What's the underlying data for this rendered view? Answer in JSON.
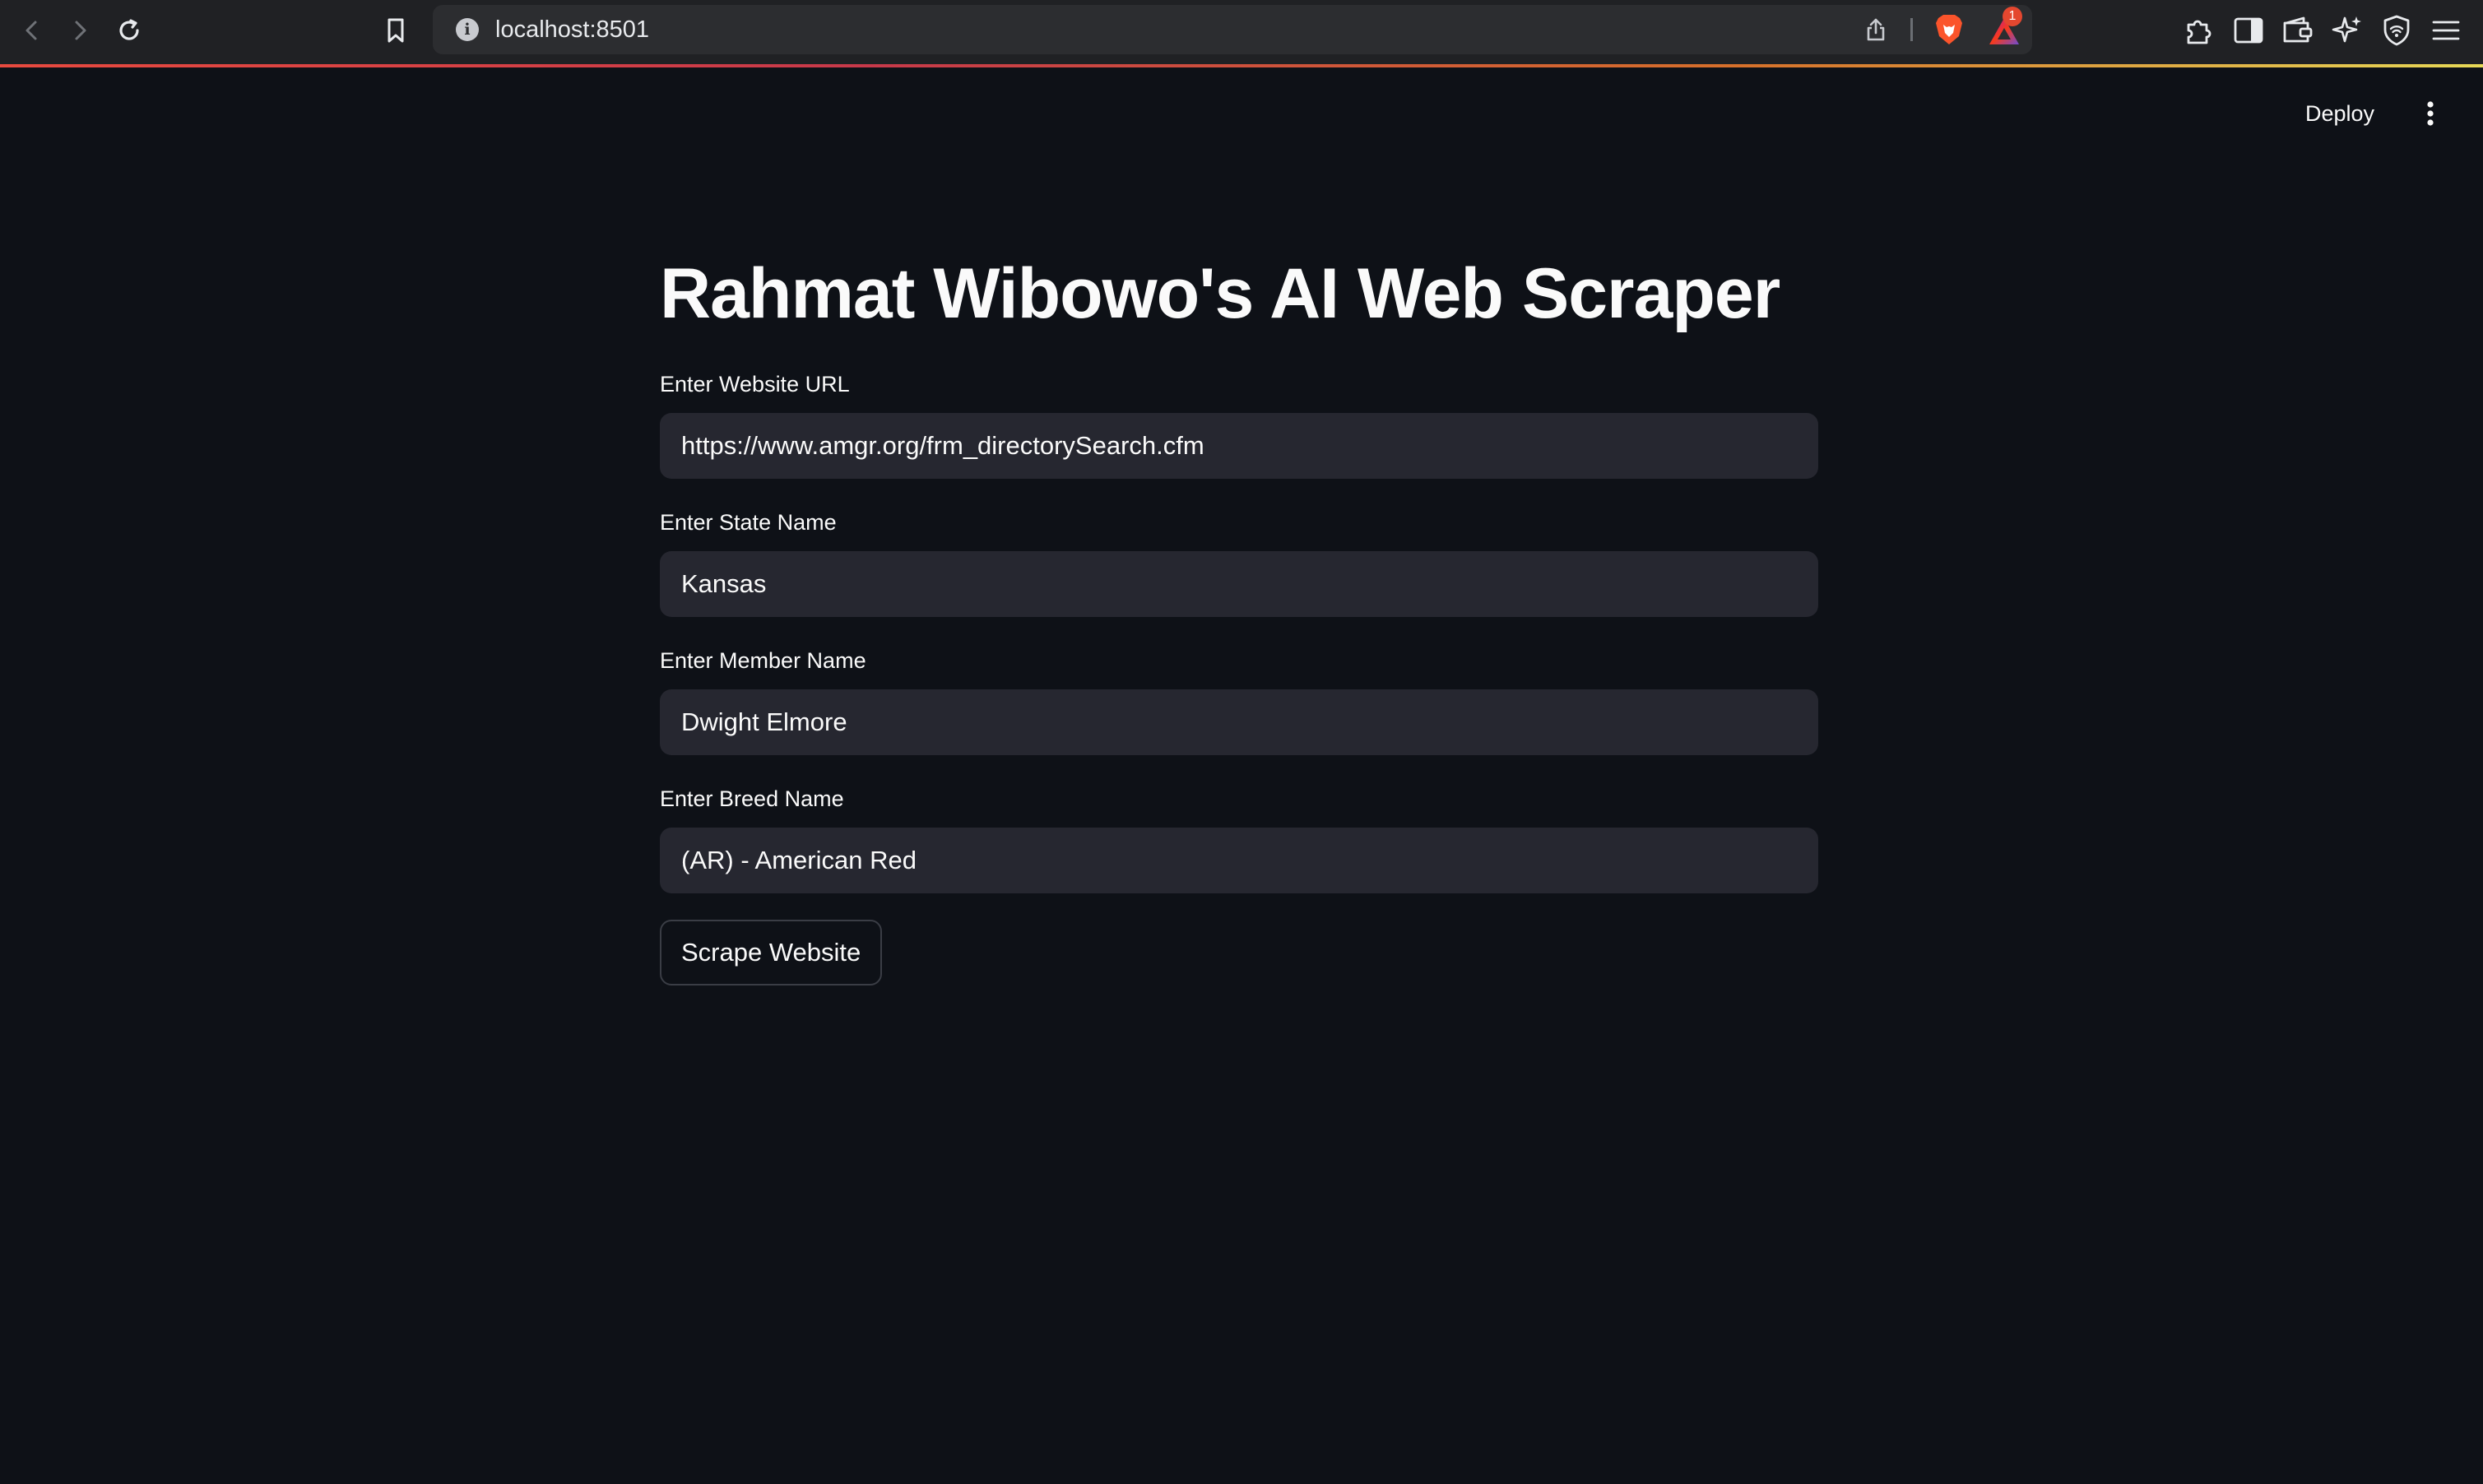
{
  "browser": {
    "url": "localhost:8501",
    "url_info_glyph": "i",
    "notification_count": "1",
    "icons": {
      "back": "chevron-left-icon",
      "forward": "chevron-right-icon",
      "reload": "reload-icon",
      "bookmark": "bookmark-icon",
      "site_info": "info-icon",
      "share": "share-icon",
      "brave_shields": "brave-lion-icon",
      "brave_rewards": "rewards-triangle-icon",
      "extensions": "puzzle-icon",
      "sidebar": "sidebar-icon",
      "wallet": "wallet-icon",
      "leo": "sparkle-icon",
      "vpn": "shield-icon",
      "menu": "hamburger-icon"
    }
  },
  "header": {
    "deploy_label": "Deploy"
  },
  "main": {
    "title": "Rahmat Wibowo's AI Web Scraper",
    "fields": [
      {
        "label": "Enter Website URL",
        "value": "https://www.amgr.org/frm_directorySearch.cfm"
      },
      {
        "label": "Enter State Name",
        "value": "Kansas"
      },
      {
        "label": "Enter Member Name",
        "value": "Dwight Elmore"
      },
      {
        "label": "Enter Breed Name",
        "value": "(AR) - American Red"
      }
    ],
    "submit_label": "Scrape Website"
  },
  "colors": {
    "app_background": "#0e1117",
    "input_background": "#262730",
    "text": "#fafafa",
    "browser_chrome": "#202124"
  }
}
